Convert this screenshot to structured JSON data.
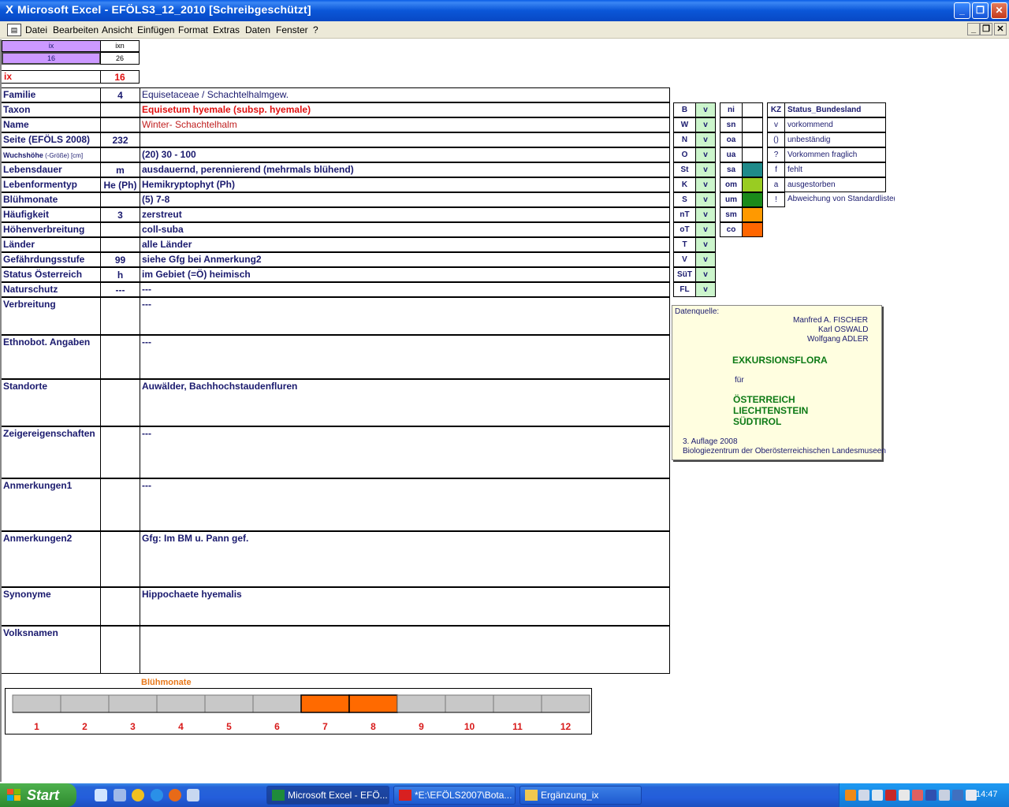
{
  "window": {
    "app_title": "Microsoft Excel - EFÖLS3_12_2010  [Schreibgeschützt]",
    "btn_minimize": "_",
    "btn_restore": "❐",
    "btn_close": "✕"
  },
  "menu": {
    "items": [
      "Datei",
      "Bearbeiten",
      "Ansicht",
      "Einfügen",
      "Format",
      "Extras",
      "Daten",
      "Fenster",
      "?"
    ],
    "mdi_minimize": "_",
    "mdi_restore": "❐",
    "mdi_close": "✕"
  },
  "index_box": {
    "header_ix": "ix",
    "header_ixn": "ixn",
    "value_ix": "16",
    "value_ixn": "26",
    "ix_label": "ix",
    "ix_value": "16"
  },
  "record": {
    "rows": [
      {
        "label": "Familie",
        "code": "4",
        "text": "Equisetaceae  /  Schachtelhalmgew."
      },
      {
        "label": "Taxon",
        "code": "",
        "text": "Equisetum hyemale (subsp. hyemale)"
      },
      {
        "label": "Name",
        "code": "",
        "text": "Winter- Schachtelhalm"
      },
      {
        "label": "Seite (EFÖLS 2008)",
        "code": "232",
        "text": ""
      },
      {
        "label": "Wuchshöhe",
        "label_small": " (-Größe) [cm]",
        "code": "",
        "text": "(20) 30 - 100"
      },
      {
        "label": "Lebensdauer",
        "code": "m",
        "text": "ausdauernd, perennierend (mehrmals blühend)"
      },
      {
        "label": "Lebenformentyp",
        "code": "He (Ph)",
        "text": "Hemikryptophyt (Ph)"
      },
      {
        "label": "Blühmonate",
        "code": "",
        "text": "(5) 7-8"
      },
      {
        "label": "Häufigkeit",
        "code": "3",
        "text": "zerstreut"
      },
      {
        "label": "Höhenverbreitung",
        "code": "",
        "text": "coll-suba"
      },
      {
        "label": "Länder",
        "code": "",
        "text": "alle Länder"
      },
      {
        "label": "Gefährdungsstufe",
        "code": "99",
        "text": "siehe Gfg bei Anmerkung2"
      },
      {
        "label": "Status Österreich",
        "code": "h",
        "text": "im Gebiet (=Ö) heimisch"
      },
      {
        "label": "Naturschutz",
        "code": "---",
        "text": "---"
      },
      {
        "label": "Verbreitung",
        "code": "",
        "text": "---"
      },
      {
        "label": "Ethnobot. Angaben",
        "code": "",
        "text": "---"
      },
      {
        "label": "Standorte",
        "code": "",
        "text": "Auwälder, Bachhochstaudenfluren"
      },
      {
        "label": "Zeigereigenschaften",
        "code": "",
        "text": "---"
      },
      {
        "label": "Anmerkungen1",
        "code": "",
        "text": "---"
      },
      {
        "label": "Anmerkungen2",
        "code": "",
        "text": "Gfg: Im BM u. Pann gef."
      },
      {
        "label": "Synonyme",
        "code": "",
        "text": "Hippochaete hyemalis"
      },
      {
        "label": "Volksnamen",
        "code": "",
        "text": ""
      }
    ]
  },
  "states": {
    "codes": [
      "B",
      "W",
      "N",
      "O",
      "St",
      "K",
      "S",
      "nT",
      "oT",
      "T",
      "V",
      "SüT",
      "FL"
    ],
    "values": [
      "v",
      "v",
      "v",
      "v",
      "v",
      "v",
      "v",
      "v",
      "v",
      "v",
      "v",
      "v",
      "v"
    ]
  },
  "altitude": {
    "codes": [
      "ni",
      "sn",
      "oa",
      "ua",
      "sa",
      "om",
      "um",
      "sm",
      "co"
    ],
    "colors": [
      "#ffffff",
      "#ffffff",
      "#ffffff",
      "#ffffff",
      "#1f8a8a",
      "#99cc22",
      "#1a8a1a",
      "#ff9900",
      "#ff6600"
    ]
  },
  "legend": {
    "header_kz": "KZ",
    "header_status": "Status_Bundesland",
    "entries": [
      {
        "kz": "v",
        "text": "vorkommend"
      },
      {
        "kz": "()",
        "text": "unbeständig"
      },
      {
        "kz": "?",
        "text": "Vorkommen fraglich"
      },
      {
        "kz": "f",
        "text": "fehlt"
      },
      {
        "kz": "a",
        "text": "ausgestorben"
      },
      {
        "kz": "!",
        "text": "Abweichung von Standardliste(?)"
      }
    ]
  },
  "source": {
    "label": "Datenquelle:",
    "author1": "Manfred A. FISCHER",
    "author2": "Karl OSWALD",
    "author3": "Wolfgang ADLER",
    "title": "EXKURSIONSFLORA",
    "fuer": "für",
    "country1": "ÖSTERREICH",
    "country2": "LIECHTENSTEIN",
    "country3": "SÜDTIROL",
    "edition": "3. Auflage 2008",
    "publisher": "Biologiezentrum der Oberösterreichischen Landesmuseen"
  },
  "bloom": {
    "title": "Blühmonate",
    "months": [
      "1",
      "2",
      "3",
      "4",
      "5",
      "6",
      "7",
      "8",
      "9",
      "10",
      "11",
      "12"
    ],
    "flowering": [
      0,
      0,
      0,
      0,
      0,
      0,
      1,
      1,
      0,
      0,
      0,
      0
    ],
    "color_on": "#ff6a00",
    "color_off": "#c8c8c8"
  },
  "taskbar": {
    "start": "Start",
    "tasks": [
      {
        "label": "Microsoft Excel - EFÖ...",
        "active": true
      },
      {
        "label": "*E:\\EFÖLS2007\\Bota...",
        "active": false
      },
      {
        "label": "Ergänzung_ix",
        "active": false
      }
    ],
    "clock": "14:47"
  }
}
